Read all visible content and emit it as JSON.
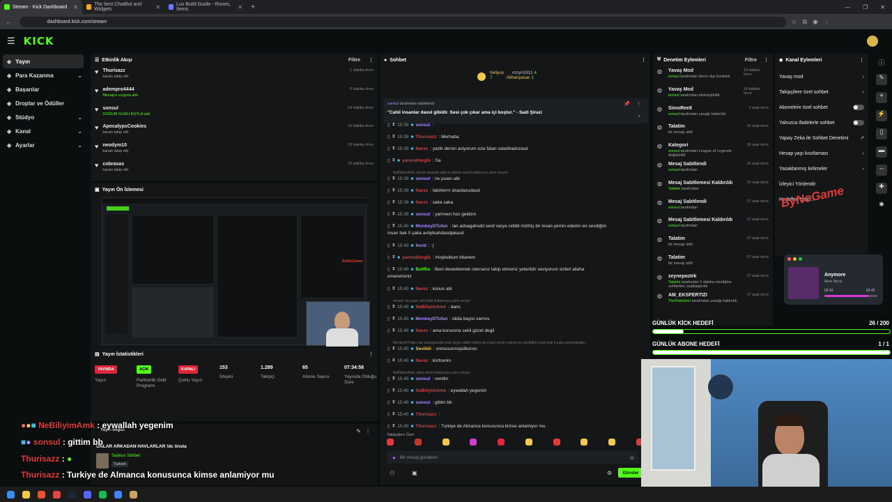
{
  "browser": {
    "tabs": [
      {
        "title": "Stream - Kick Dashboard",
        "color": "#53fc18"
      },
      {
        "title": "The best ChatBot and Widgets",
        "color": "#f5a623"
      },
      {
        "title": "Lux Build Guide - Runes, Items",
        "color": "#6b7cff"
      }
    ],
    "url": "dashboard.kick.com/stream"
  },
  "brand": {
    "logo": "KICK"
  },
  "sidebar": {
    "items": [
      {
        "label": "Yayın",
        "icon": "stream-icon",
        "chevron": false
      },
      {
        "label": "Para Kazanma",
        "icon": "money-icon",
        "chevron": true
      },
      {
        "label": "Başarılar",
        "icon": "trophy-icon",
        "chevron": false
      },
      {
        "label": "Droplar ve Ödüller",
        "icon": "gift-icon",
        "chevron": false
      },
      {
        "label": "Stüdyo",
        "icon": "studio-icon",
        "chevron": true
      },
      {
        "label": "Kanal",
        "icon": "channel-icon",
        "chevron": true
      },
      {
        "label": "Ayarlar",
        "icon": "gear-icon",
        "chevron": true
      }
    ]
  },
  "activity": {
    "title": "Etkinlik Akışı",
    "filter": "Filtre",
    "items": [
      {
        "name": "Thurisazz",
        "sub": "kanalı takip etti",
        "time": "1 dakika önce",
        "green": false
      },
      {
        "name": "adempro4444",
        "sub": "Mesajını vurgula aldı",
        "time": "5 dakika önce",
        "green": true
      },
      {
        "name": "sonsul",
        "sub": "DOĞUM GÜNÜ KUTLA aldı",
        "time": "14 dakika önce",
        "green": true
      },
      {
        "name": "ApocalypsCookies",
        "sub": "kanalı takip etti",
        "time": "19 dakika önce",
        "green": false
      },
      {
        "name": "neodym10",
        "sub": "kanalı takip etti",
        "time": "19 dakika önce",
        "green": false
      },
      {
        "name": "cobrasas",
        "sub": "kanalı takip etti",
        "time": "19 dakika önce",
        "green": false
      }
    ]
  },
  "preview": {
    "title": "Yayın Ön İzlemesi",
    "watermark": "ByNoGame"
  },
  "stats": {
    "title": "Yayın İstatistikleri",
    "items": [
      {
        "badge": "YAYINDA",
        "badge_color": "#e0263a",
        "label": "Yayın"
      },
      {
        "badge": "AÇIK",
        "badge_color": "#53fc18",
        "label": "Partnerlik Gelir Programı"
      },
      {
        "badge": "KAPALI",
        "badge_color": "#e0263a",
        "label": "Çoklu Yayın"
      },
      {
        "value": "153",
        "label": "İzleyici"
      },
      {
        "value": "1.289",
        "label": "Takipçi"
      },
      {
        "value": "65",
        "label": "Abone Sayısı"
      },
      {
        "value": "07:34:58",
        "label": "Yayında Olduğu Süre"
      }
    ]
  },
  "info": {
    "title": "Yayın bilgisi",
    "stream_title": "ONLAR ARKADAN HAVLARLAR !dc linsta",
    "category": "Sadece Sohbet",
    "lang": "Turkish"
  },
  "overlay": [
    {
      "user": "NeBiliyimAmk",
      "msg": ": eywallah yegenim",
      "color": "#e03b3b"
    },
    {
      "user": "sonsul",
      "msg": ": gittim bb",
      "color": "#e03b3b"
    },
    {
      "user": "Thurisazz",
      "msg": ":",
      "color": "#e03b3b"
    },
    {
      "user": "Thurisazz",
      "msg": ": Turkiye de Almanca konusunca kimse anlamiyor mu",
      "color": "#e03b3b"
    }
  ],
  "chat": {
    "title": "Sohbet",
    "top": [
      {
        "name": "heliyus",
        "val": "7"
      },
      {
        "name": "mzyn3311",
        "val": "4"
      },
      {
        "name": "Alihanyasar",
        "val": "1"
      }
    ],
    "pinned": {
      "by": "sonsul",
      "by_suffix": "tarafından sabitlendi",
      "text": "\"Cahil insanlar davul gibidir. Sesi çok çıkar ama içi boştur.\" - Sadi Şirazi"
    },
    "lines": [
      {
        "time": "15:39",
        "user": "sonsul",
        "msg": ":",
        "c": "u-p"
      },
      {
        "time": "15:39",
        "user": "Thurisazz",
        "msg": ": Merhaba",
        "c": "u-r"
      },
      {
        "time": "15:39",
        "user": "Narez",
        "msg": ": yazik dersin aciyorum size falan sdaoihadszasd",
        "c": "u-r"
      },
      {
        "time": "",
        "user": "yarenafiergib",
        "msg": ": Sa",
        "c": "u-r"
      },
      {
        "sys": "NeBiliyimAmk: benim puanimi iade et silarim isimli kullanıcıya yanıt veriyor"
      },
      {
        "time": "15:39",
        "user": "sonsul",
        "msg": ": ne puanı abi",
        "c": "u-p"
      },
      {
        "time": "15:39",
        "user": "Narez",
        "msg": ": fakirlerrrr dsaoiazudasd",
        "c": "u-r"
      },
      {
        "time": "15:39",
        "user": "Narez",
        "msg": ": saka saka",
        "c": "u-r"
      },
      {
        "time": "15:39",
        "user": "sonsul",
        "msg": ": yarrreen hos geldinn",
        "c": "u-p"
      },
      {
        "time": "15:40",
        "user": "MonkeyDTufan",
        "msg": ": lan adsagahsdd sevil varya ciddili müthiş bir insan yemin ederim en sevdiğim",
        "c": "u-p",
        "cont": "insan bak 0 şaka ashjdsahdasdjakasd"
      },
      {
        "time": "15:40",
        "user": "focid",
        "msg": ": :)",
        "c": "u-p"
      },
      {
        "time": "",
        "user": "yarenafiergib",
        "msg": ": Hoşbuldum bitanem",
        "c": "u-r"
      },
      {
        "time": "15:40",
        "user": "BotRix",
        "msg": ": Beni desteklemek istersenz takip etmeniz yeterlidir seviyorum sizleri allaha",
        "c": "u-g",
        "cont": "emanetsiniz"
      },
      {
        "time": "15:40",
        "user": "Narez",
        "msg": ": konus abi",
        "c": "u-r"
      },
      {
        "sys": "sonsul: ne puanı abi isimli kullanıcıya yanıt veriyor"
      },
      {
        "time": "15:40",
        "user": "NeBiliyimAmk",
        "msg": ": dans",
        "c": "u-r"
      },
      {
        "time": "15:40",
        "user": "MonkeyDTufan",
        "msg": ": iddia bayisi varmıs",
        "c": "u-p"
      },
      {
        "time": "15:40",
        "user": "Narez",
        "msg": ": ama konusma sekli güzel degil",
        "c": "u-r"
      },
      {
        "sys": "MonkeyDTufan: lan adsagahsdd sevil varya ciddili müthiş bir insan yemin ederim en sevdiğim insan bak 0 şaka ashjdsahdas..."
      },
      {
        "time": "15:40",
        "user": "Seviiiiii",
        "msg": ": snnssssnnsjsdksnsn",
        "c": "u-y"
      },
      {
        "time": "15:40",
        "user": "Narez",
        "msg": ": kürtcenin",
        "c": "u-r"
      },
      {
        "sys": "NeBiliyimAmk: dans isimli kullanıcıya yanıt veriyor"
      },
      {
        "time": "15:40",
        "user": "sonsul",
        "msg": ": verdim",
        "c": "u-p"
      },
      {
        "time": "15:40",
        "user": "NeBiliyimAmk",
        "msg": ": eywallah yegenim",
        "c": "u-r"
      },
      {
        "time": "15:40",
        "user": "sonsul",
        "msg": ": gittim bb",
        "c": "u-p"
      },
      {
        "time": "15:40",
        "user": "Thurisazz",
        "msg": ":",
        "c": "u-r"
      },
      {
        "time": "15:40",
        "user": "Thurisazz",
        "msg": ": Turkiye de Almanca konusunca kimse anlamiyor mu",
        "c": "u-r"
      }
    ],
    "followers_only": "Takipçilere Özel",
    "placeholder": "Bir mesaj gönderin",
    "send": "Gönder"
  },
  "mod": {
    "title": "Denetim Eylemleri",
    "filter": "Filtre",
    "items": [
      {
        "title": "Yavaş Mod",
        "sub_pre": "",
        "sub_user": "sonsul",
        "sub": "tarafından devre dışı bırakıldı",
        "time": "13 dakika önce",
        "icon": "slow-mode-icon"
      },
      {
        "title": "Yavaş Mod",
        "sub_pre": "",
        "sub_user": "sonsul",
        "sub": "tarafından etkinleştirildi",
        "time": "14 dakika önce",
        "icon": "slow-mode-icon"
      },
      {
        "title": "SimoRee8",
        "sub_pre": "",
        "sub_user": "sonsul",
        "sub": "tarafından yasağı kaldırıldı",
        "time": "1 saat önce",
        "icon": "unban-icon"
      },
      {
        "title": "Talatim",
        "sub_pre": "bir mesajı sildi",
        "sub_user": "",
        "sub": "",
        "time": "15 saat önce",
        "icon": "trash-icon"
      },
      {
        "title": "Kategori",
        "sub_pre": "",
        "sub_user": "sonsul",
        "sub": "tarafından League of Legends değiştirildi",
        "time": "16 saat önce",
        "icon": "category-icon"
      },
      {
        "title": "Mesaj Sabitlendi",
        "sub_pre": "",
        "sub_user": "sonsul",
        "sub": "tarafından",
        "time": "16 saat önce",
        "icon": "pin-icon"
      },
      {
        "title": "Mesaj Sabitlemesi Kaldırıldı",
        "sub_pre": "",
        "sub_user": "Talatim",
        "sub": "tarafından",
        "time": "16 saat önce",
        "icon": "unpin-icon"
      },
      {
        "title": "Mesaj Sabitlendi",
        "sub_pre": "",
        "sub_user": "sonsul",
        "sub": "tarafından",
        "time": "17 saat önce",
        "icon": "pin-icon"
      },
      {
        "title": "Mesaj Sabitlemesi Kaldırıldı",
        "sub_pre": "",
        "sub_user": "sonsul",
        "sub": "tarafından",
        "time": "17 saat önce",
        "icon": "unpin-icon"
      },
      {
        "title": "Talatim",
        "sub_pre": "bir mesajı sildi",
        "sub_user": "",
        "sub": "",
        "time": "17 saat önce",
        "icon": "trash-icon"
      },
      {
        "title": "Talatim",
        "sub_pre": "bir mesajı sildi",
        "sub_user": "",
        "sub": "",
        "time": "17 saat önce",
        "icon": "trash-icon"
      },
      {
        "title": "zeynepoztrk",
        "sub_pre": "",
        "sub_user": "Talatim",
        "sub": "tarafından 2 dakika süreliğine sohbetten uzaklaştırıldı",
        "time": "17 saat önce",
        "icon": "timeout-icon"
      },
      {
        "title": "AM_EKSPERTIZI",
        "sub_pre": "",
        "sub_user": "ThePublisher",
        "sub": "tarafından yasağı kaldırıldı",
        "time": "17 saat önce",
        "icon": "unban-icon"
      }
    ]
  },
  "channel": {
    "title": "Kanal Eylemleri",
    "items": [
      {
        "label": "Yavaş mod",
        "ctl": "›"
      },
      {
        "label": "Takipçilere özel sohbet",
        "ctl": "›"
      },
      {
        "label": "Aboneler̈e özel sohbet",
        "ctl": "toggle"
      },
      {
        "label": "Yalnızca ifadelerle sohbet",
        "ctl": "toggle"
      },
      {
        "label": "Yapay Zeka ile Sohbet Denetimi",
        "ctl": "↗"
      },
      {
        "label": "Hesap yaşı kısıtlaması",
        "ctl": "›"
      },
      {
        "label": "Yasaklanmış kelimeler",
        "ctl": "›"
      },
      {
        "label": "İzleyici Yönlendir",
        "ctl": ""
      },
      {
        "label": "Hedefleri belirl...",
        "ctl": ""
      }
    ],
    "overlay_logo": "ByNoGame"
  },
  "music": {
    "title": "Anymore",
    "artist": "Ayen Necio",
    "elapsed": "02:16",
    "total": "02:42",
    "progress": 0.84
  },
  "goals": [
    {
      "label": "GÜNLÜK KİCK HEDEFİ",
      "value": "26 / 200",
      "progress": 0.13
    },
    {
      "label": "GÜNLÜK ABONE HEDEFİ",
      "value": "1 / 1",
      "progress": 1.0
    }
  ]
}
